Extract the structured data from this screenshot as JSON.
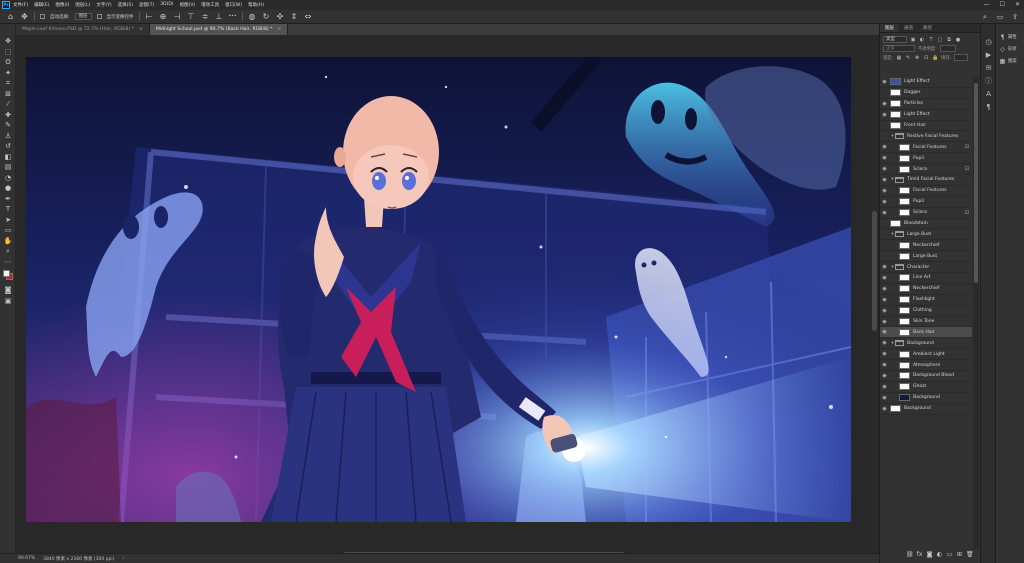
{
  "app": {
    "logo": "Ps"
  },
  "menu": [
    "文件(F)",
    "编辑(E)",
    "图像(I)",
    "图层(L)",
    "文字(Y)",
    "选择(S)",
    "滤镜(T)",
    "3D(D)",
    "视图(V)",
    "增效工具",
    "窗口(W)",
    "帮助(H)"
  ],
  "window_controls": {
    "minimize": "—",
    "maximize": "☐",
    "close": "✕"
  },
  "options": {
    "home_icon": "home-icon",
    "move_icon": "move-icon",
    "autoselect_label": "自动选择:",
    "layer_select": "图层",
    "transform_label": "显示变换控件",
    "more": "•••"
  },
  "tabs": [
    {
      "label": "Maple Leaf Kimono.PSD @ 72.7% (Hair, RGB/8) *",
      "close": "×",
      "active": false
    },
    {
      "label": "Midnight School.psd @ 90.7% (Back Hair, RGB/8) *",
      "close": "×",
      "active": true
    }
  ],
  "status": {
    "zoom": "90.67%",
    "doc_info": "3840 像素 x 2160 像素 (300 ppi)",
    "arrow": "›"
  },
  "layers_panel": {
    "tabs": [
      "图层",
      "通道",
      "路径"
    ],
    "filter_type": "类型",
    "blend_mode": "正常",
    "opacity_label": "不透明度:",
    "lock_label": "锁定:",
    "fill_label": "填充:"
  },
  "layers": [
    {
      "name": "Light Effect",
      "kind": "layer",
      "visible": true,
      "depth": 0,
      "locked": false,
      "thumb": "art"
    },
    {
      "name": "Dagger",
      "kind": "layer",
      "visible": false,
      "depth": 0,
      "locked": false,
      "thumb": "white"
    },
    {
      "name": "Particles",
      "kind": "layer",
      "visible": true,
      "depth": 0,
      "locked": false,
      "thumb": "white"
    },
    {
      "name": "Light Effect",
      "kind": "layer",
      "visible": true,
      "depth": 0,
      "locked": false,
      "thumb": "white"
    },
    {
      "name": "Front Hair",
      "kind": "layer",
      "visible": false,
      "depth": 0,
      "locked": false,
      "thumb": "white"
    },
    {
      "name": "Restive Facial Features",
      "kind": "group",
      "visible": false,
      "depth": 0,
      "locked": false
    },
    {
      "name": "Facial Features",
      "kind": "layer",
      "visible": true,
      "depth": 1,
      "locked": true,
      "thumb": "white"
    },
    {
      "name": "Pupil",
      "kind": "layer",
      "visible": true,
      "depth": 1,
      "locked": false,
      "thumb": "white"
    },
    {
      "name": "Sclera",
      "kind": "layer",
      "visible": true,
      "depth": 1,
      "locked": true,
      "thumb": "white"
    },
    {
      "name": "Timid Facial Features",
      "kind": "group",
      "visible": true,
      "depth": 0,
      "locked": false
    },
    {
      "name": "Facial Features",
      "kind": "layer",
      "visible": true,
      "depth": 1,
      "locked": false,
      "thumb": "white"
    },
    {
      "name": "Pupil",
      "kind": "layer",
      "visible": true,
      "depth": 1,
      "locked": false,
      "thumb": "white"
    },
    {
      "name": "Sclera",
      "kind": "layer",
      "visible": true,
      "depth": 1,
      "locked": true,
      "thumb": "white"
    },
    {
      "name": "Bloodstain",
      "kind": "layer",
      "visible": false,
      "depth": 0,
      "locked": false,
      "thumb": "white"
    },
    {
      "name": "Large Bust",
      "kind": "group",
      "visible": false,
      "depth": 0,
      "locked": false
    },
    {
      "name": "Neckerchief",
      "kind": "layer",
      "visible": false,
      "depth": 1,
      "locked": false,
      "thumb": "white"
    },
    {
      "name": "Large Bust",
      "kind": "layer",
      "visible": false,
      "depth": 1,
      "locked": false,
      "thumb": "white"
    },
    {
      "name": "Character",
      "kind": "group",
      "visible": true,
      "depth": 0,
      "locked": false
    },
    {
      "name": "Line Art",
      "kind": "layer",
      "visible": true,
      "depth": 1,
      "locked": false,
      "thumb": "white"
    },
    {
      "name": "Neckerchief",
      "kind": "layer",
      "visible": true,
      "depth": 1,
      "locked": false,
      "thumb": "white"
    },
    {
      "name": "Flashlight",
      "kind": "layer",
      "visible": true,
      "depth": 1,
      "locked": false,
      "thumb": "white"
    },
    {
      "name": "Clothing",
      "kind": "layer",
      "visible": true,
      "depth": 1,
      "locked": false,
      "thumb": "white"
    },
    {
      "name": "Skin Tone",
      "kind": "layer",
      "visible": true,
      "depth": 1,
      "locked": false,
      "thumb": "white"
    },
    {
      "name": "Back Hair",
      "kind": "layer",
      "visible": true,
      "depth": 1,
      "locked": false,
      "thumb": "white",
      "selected": true
    },
    {
      "name": "Background",
      "kind": "group",
      "visible": true,
      "depth": 0,
      "locked": false
    },
    {
      "name": "Ambient Light",
      "kind": "layer",
      "visible": true,
      "depth": 1,
      "locked": false,
      "thumb": "white"
    },
    {
      "name": "Atmosphere",
      "kind": "layer",
      "visible": true,
      "depth": 1,
      "locked": false,
      "thumb": "white"
    },
    {
      "name": "Background Blood",
      "kind": "layer",
      "visible": true,
      "depth": 1,
      "locked": false,
      "thumb": "white"
    },
    {
      "name": "Ghost",
      "kind": "layer",
      "visible": true,
      "depth": 1,
      "locked": false,
      "thumb": "white"
    },
    {
      "name": "Background",
      "kind": "layer",
      "visible": true,
      "depth": 1,
      "locked": false,
      "thumb": "dark"
    },
    {
      "name": "Background",
      "kind": "layer",
      "visible": true,
      "depth": 0,
      "locked": false,
      "thumb": "white"
    }
  ],
  "side_panel": [
    {
      "icon": "paragraph-icon",
      "glyph": "¶",
      "label": "属性"
    },
    {
      "icon": "shapes-icon",
      "glyph": "◇",
      "label": "形状"
    },
    {
      "icon": "pattern-icon",
      "glyph": "▦",
      "label": "图案"
    }
  ],
  "colors": {
    "accent": "#31a8ff",
    "bg": "#cc1b1b",
    "fg": "#f4f4f4"
  }
}
